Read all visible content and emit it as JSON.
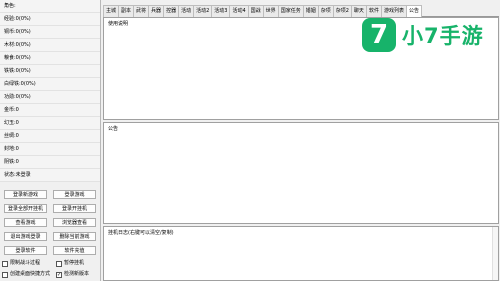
{
  "stats": [
    "角色:",
    "经验:0(0%)",
    "铜币:0(0%)",
    "木材:0(0%)",
    "粮食:0(0%)",
    "铁铁:0(0%)",
    "白绿铁:0(0%)",
    "功勋:0(0%)",
    "金币:0",
    "幻玉:0",
    "丝绸:0",
    "封地:0",
    "阴铁:0",
    "状态:未登录"
  ],
  "buttons": [
    "登录新游戏",
    "登录游戏",
    "登录全部开挂机",
    "登录开挂机",
    "查看游戏",
    "浏览器查看",
    "退出游戏登录",
    "删除当前游戏",
    "登录软件",
    "软件充值"
  ],
  "checkboxes": [
    {
      "label": "限制战斗过程",
      "checked": false
    },
    {
      "label": "暂停挂机",
      "checked": false
    },
    {
      "label": "创建桌面快捷方式",
      "checked": false
    },
    {
      "label": "检测新版本",
      "checked": true
    }
  ],
  "tabs": [
    "主城",
    "副本",
    "武将",
    "兵器",
    "控器",
    "活动",
    "活动2",
    "活动3",
    "活动4",
    "国战",
    "世界",
    "国家任务",
    "婚姻",
    "杂项",
    "杂项2",
    "聊天",
    "软件",
    "游戏列表",
    "公告"
  ],
  "active_tab": "公告",
  "panels": {
    "usage_label": "使用说明",
    "notice_label": "公告",
    "log_label": "挂机日志(右键可以清空/复制)"
  },
  "logo": {
    "mark": "7",
    "text": "小7手游",
    "color": "#17b36a"
  }
}
